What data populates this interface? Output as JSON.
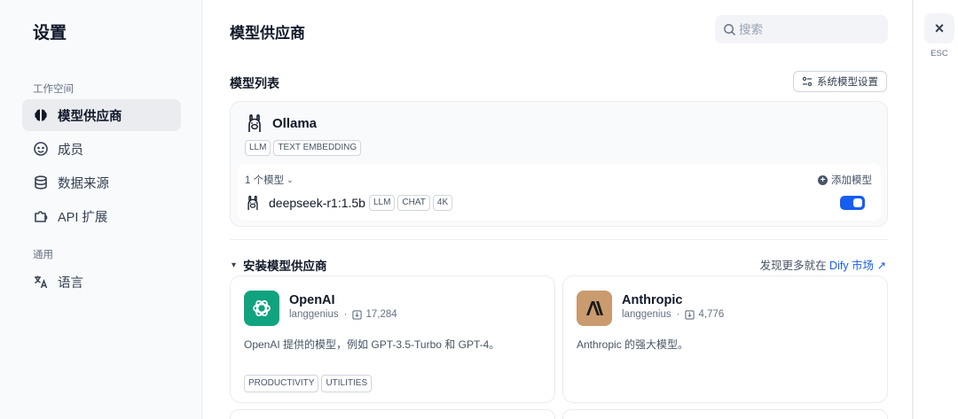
{
  "sidebar": {
    "title": "设置",
    "workspace_label": "工作空间",
    "general_label": "通用",
    "items": [
      {
        "label": "模型供应商",
        "icon": "brain-icon",
        "active": true
      },
      {
        "label": "成员",
        "icon": "members-icon"
      },
      {
        "label": "数据来源",
        "icon": "database-icon"
      },
      {
        "label": "API 扩展",
        "icon": "puzzle-icon"
      },
      {
        "label": "语言",
        "icon": "translate-icon"
      }
    ]
  },
  "header": {
    "title": "模型供应商",
    "search_placeholder": "搜索"
  },
  "model_list": {
    "title": "模型列表",
    "system_settings_label": "系统模型设置"
  },
  "provider": {
    "name": "Ollama",
    "tags": [
      "LLM",
      "TEXT EMBEDDING"
    ],
    "model_count": "1 个模型",
    "add_model_label": "添加模型",
    "model": {
      "name": "deepseek-r1:1.5b",
      "tags": [
        "LLM",
        "CHAT",
        "4K"
      ],
      "enabled": true
    }
  },
  "install": {
    "title": "安装模型供应商",
    "market_prefix": "发现更多就在 ",
    "market_link": "Dify 市场 ↗",
    "plugins": [
      {
        "name": "OpenAI",
        "author": "langgenius",
        "downloads": "17,284",
        "description": "OpenAI 提供的模型，例如 GPT-3.5-Turbo 和 GPT-4。",
        "tags": [
          "PRODUCTIVITY",
          "UTILITIES"
        ],
        "logo_color": "#10a37f"
      },
      {
        "name": "Anthropic",
        "author": "langgenius",
        "downloads": "4,776",
        "description": "Anthropic 的强大模型。",
        "tags": [],
        "logo_color": "#c99b6e"
      }
    ]
  },
  "close": {
    "icon": "×",
    "esc_label": "ESC"
  },
  "colors": {
    "accent": "#155eef",
    "sidebar_bg": "#f9fafb",
    "active_item_bg": "#eaecf0"
  }
}
